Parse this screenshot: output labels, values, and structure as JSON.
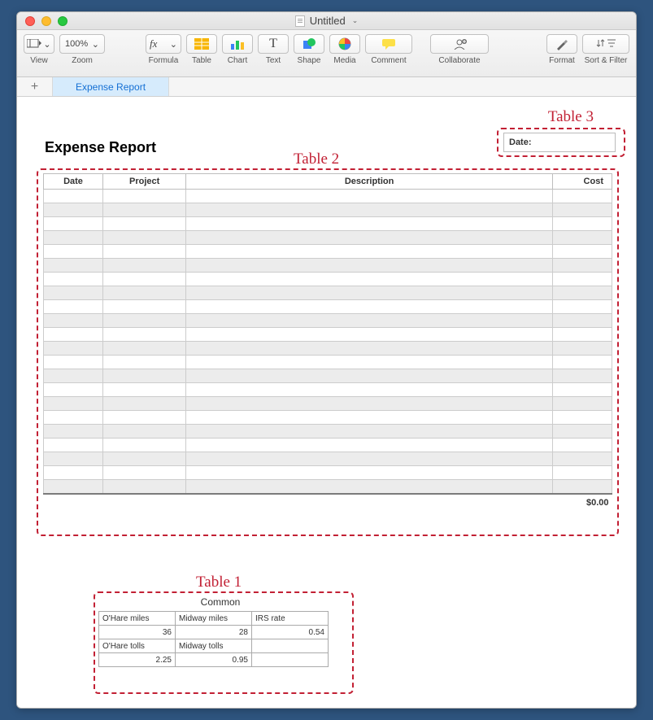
{
  "window": {
    "title": "Untitled"
  },
  "toolbar": {
    "view": "View",
    "zoom_value": "100%",
    "zoom_label": "Zoom",
    "formula": "Formula",
    "table": "Table",
    "chart": "Chart",
    "text": "Text",
    "shape": "Shape",
    "media": "Media",
    "comment": "Comment",
    "collaborate": "Collaborate",
    "format": "Format",
    "sortfilter": "Sort & Filter"
  },
  "sheets": {
    "active": "Expense Report"
  },
  "document": {
    "title": "Expense Report",
    "date_label": "Date:",
    "table2": {
      "columns": [
        "Date",
        "Project",
        "Description",
        "Cost"
      ],
      "total": "$0.00",
      "rows": 22
    },
    "table1": {
      "title": "Common",
      "row1": [
        "O'Hare miles",
        "Midway miles",
        "IRS rate"
      ],
      "row2": [
        "36",
        "28",
        "0.54"
      ],
      "row3": [
        "O'Hare tolls",
        "Midway tolls",
        ""
      ],
      "row4": [
        "2.25",
        "0.95",
        ""
      ]
    }
  },
  "annotations": {
    "t1": "Table 1",
    "t2": "Table 2",
    "t3": "Table 3"
  },
  "chart_data": {
    "type": "table",
    "tables": [
      {
        "name": "Expense Report",
        "columns": [
          "Date",
          "Project",
          "Description",
          "Cost"
        ],
        "rows": [],
        "total": 0.0
      },
      {
        "name": "Common",
        "data": {
          "O'Hare miles": 36,
          "Midway miles": 28,
          "IRS rate": 0.54,
          "O'Hare tolls": 2.25,
          "Midway tolls": 0.95
        }
      },
      {
        "name": "Date",
        "columns": [
          "Date"
        ],
        "rows": [
          ""
        ]
      }
    ]
  }
}
